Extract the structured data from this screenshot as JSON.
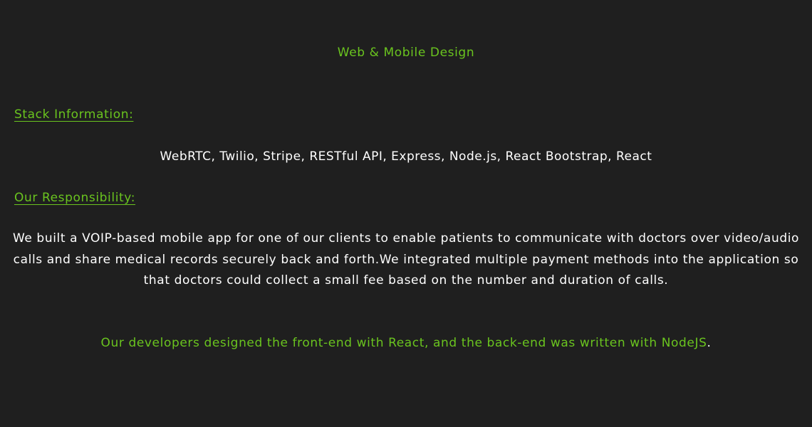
{
  "category": "Web & Mobile Design",
  "stack": {
    "heading": "Stack Information:",
    "technologies": "WebRTC, Twilio, Stripe, RESTful API, Express, Node.js, React Bootstrap, React"
  },
  "responsibility": {
    "heading": "Our Responsibility:",
    "text": "We built a VOIP-based mobile app for one of our clients to enable patients to communicate with doctors over video/audio calls and share medical records securely back and forth.We integrated multiple payment methods into the application so that doctors could collect a small fee based on the number and duration of calls."
  },
  "developer_note": {
    "text": "Our developers designed the front-end with React, and the back-end was written with NodeJS",
    "trailing": "."
  },
  "colors": {
    "background": "#1f1f1f",
    "accent": "#6ac41f",
    "text": "#ffffff"
  }
}
